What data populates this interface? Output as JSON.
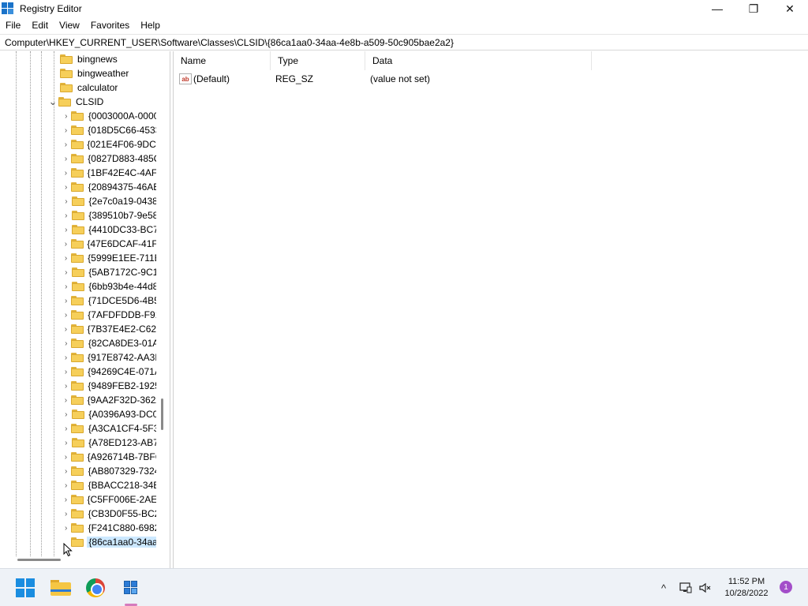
{
  "window": {
    "title": "Registry Editor",
    "minimize_icon": "—",
    "restore_icon": "❐",
    "close_icon": "✕"
  },
  "menu": {
    "items": [
      "File",
      "Edit",
      "View",
      "Favorites",
      "Help"
    ]
  },
  "address": {
    "path": "Computer\\HKEY_CURRENT_USER\\Software\\Classes\\CLSID\\{86ca1aa0-34aa-4e8b-a509-50c905bae2a2}"
  },
  "tree": {
    "top_items": [
      "bingnews",
      "bingweather",
      "calculator"
    ],
    "expanded": "CLSID",
    "children": [
      "{0003000A-0000",
      "{018D5C66-4533",
      "{021E4F06-9DCC",
      "{0827D883-485C",
      "{1BF42E4C-4AF4",
      "{20894375-46AE",
      "{2e7c0a19-0438",
      "{389510b7-9e58",
      "{4410DC33-BC7",
      "{47E6DCAF-41F8",
      "{5999E1EE-711E",
      "{5AB7172C-9C1",
      "{6bb93b4e-44d8",
      "{71DCE5D6-4B5",
      "{7AFDFDDB-F91",
      "{7B37E4E2-C62F",
      "{82CA8DE3-01A",
      "{917E8742-AA3E",
      "{94269C4E-071A",
      "{9489FEB2-1925",
      "{9AA2F32D-362A",
      "{A0396A93-DC0",
      "{A3CA1CF4-5F3",
      "{A78ED123-AB7",
      "{A926714B-7BFC",
      "{AB807329-7324",
      "{BBACC218-34E",
      "{C5FF006E-2AE9",
      "{CB3D0F55-BC2",
      "{F241C880-6982",
      "{86ca1aa0-34aa-"
    ],
    "selected_index": 30
  },
  "values": {
    "columns": [
      "Name",
      "Type",
      "Data"
    ],
    "rows": [
      {
        "name": "(Default)",
        "type": "REG_SZ",
        "data": "(value not set)",
        "icon": "ab"
      }
    ]
  },
  "taskbar": {
    "apps": [
      "start-icon",
      "file-explorer-icon",
      "chrome-icon",
      "registry-editor-icon"
    ],
    "tray": {
      "chevron": "^",
      "time": "11:52 PM",
      "date": "10/28/2022",
      "notification_count": "1"
    }
  }
}
